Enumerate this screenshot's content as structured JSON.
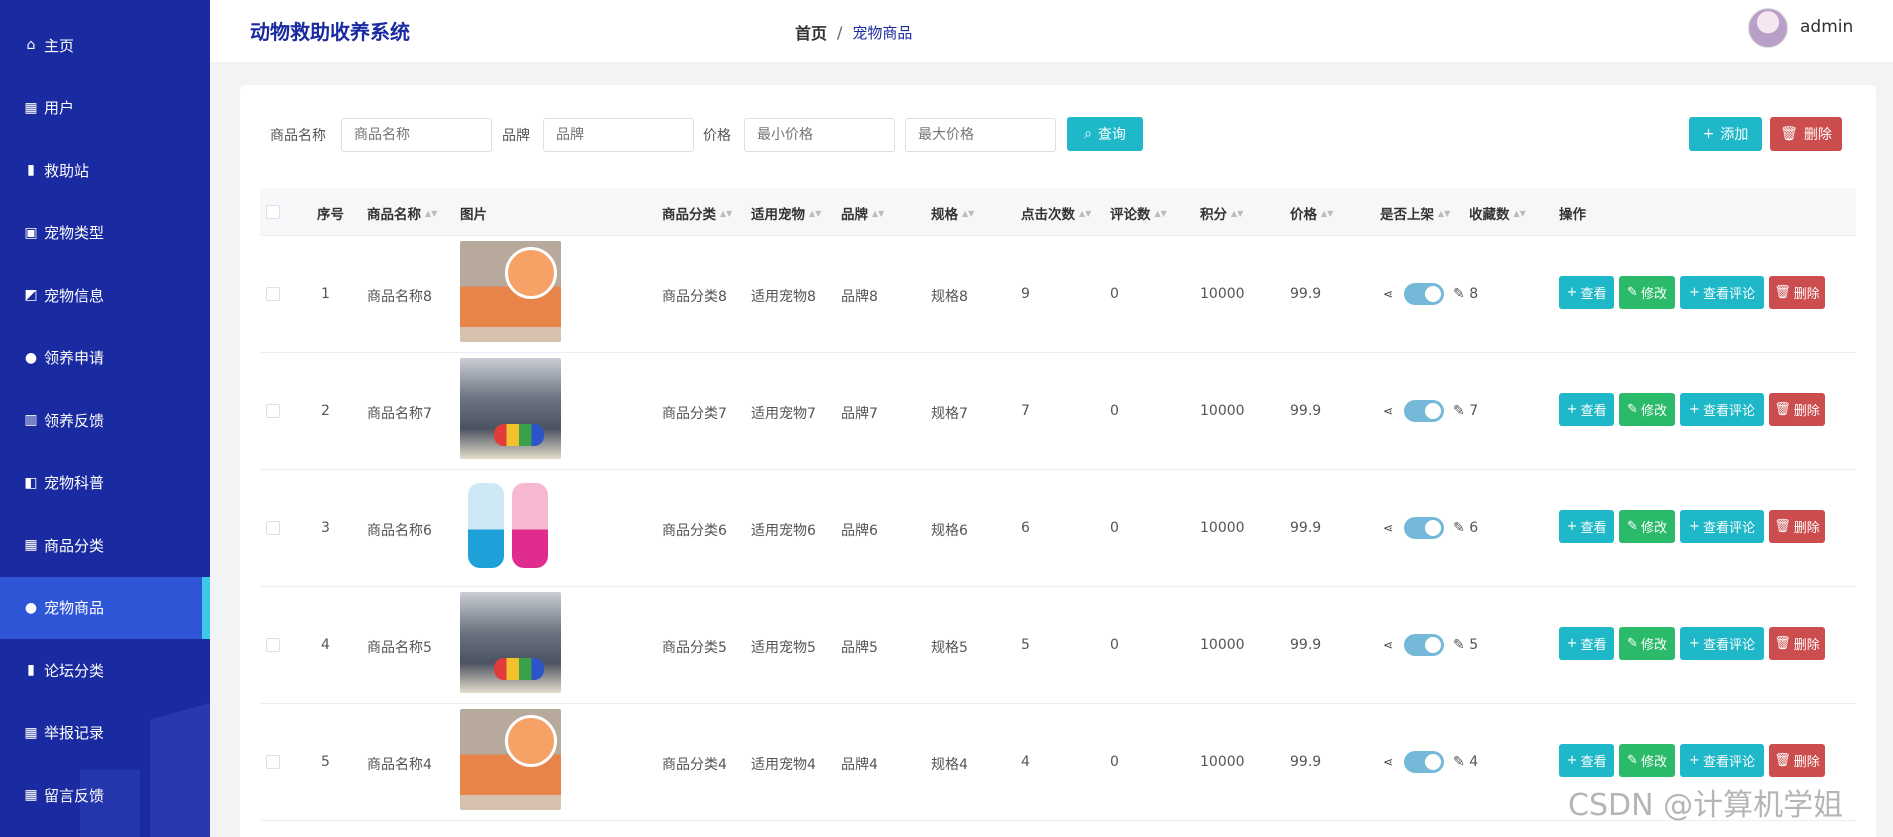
{
  "app": {
    "title": "动物救助收养系统",
    "user": "admin"
  },
  "breadcrumb": {
    "home": "首页",
    "separator": "/",
    "current": "宠物商品"
  },
  "sidebar": {
    "items": [
      {
        "label": "主页",
        "icon": "home-icon",
        "glyph": "⌂"
      },
      {
        "label": "用户",
        "icon": "grid-icon",
        "glyph": "▦"
      },
      {
        "label": "救助站",
        "icon": "bookmark-icon",
        "glyph": "▮"
      },
      {
        "label": "宠物类型",
        "icon": "clipboard-icon",
        "glyph": "▣"
      },
      {
        "label": "宠物信息",
        "icon": "chart-icon",
        "glyph": "◩"
      },
      {
        "label": "领养申请",
        "icon": "user-icon",
        "glyph": "●"
      },
      {
        "label": "领养反馈",
        "icon": "bar-chart-icon",
        "glyph": "▥"
      },
      {
        "label": "宠物科普",
        "icon": "thumbs-up-icon",
        "glyph": "◧"
      },
      {
        "label": "商品分类",
        "icon": "grid-icon",
        "glyph": "▦"
      },
      {
        "label": "宠物商品",
        "icon": "user-icon",
        "glyph": "●",
        "active": true
      },
      {
        "label": "论坛分类",
        "icon": "bookmark-icon",
        "glyph": "▮"
      },
      {
        "label": "举报记录",
        "icon": "grid-icon",
        "glyph": "▦"
      },
      {
        "label": "留言反馈",
        "icon": "grid-icon",
        "glyph": "▦"
      }
    ]
  },
  "filters": {
    "name_label": "商品名称",
    "name_placeholder": "商品名称",
    "brand_label": "品牌",
    "brand_placeholder": "品牌",
    "price_label": "价格",
    "min_price_placeholder": "最小价格",
    "max_price_placeholder": "最大价格",
    "search_button": "查询",
    "add_button": "添加",
    "delete_button": "删除"
  },
  "table": {
    "columns": [
      "序号",
      "商品名称",
      "图片",
      "商品分类",
      "适用宠物",
      "品牌",
      "规格",
      "点击次数",
      "评论数",
      "积分",
      "价格",
      "是否上架",
      "收藏数",
      "操作"
    ],
    "actions": {
      "view": "查看",
      "edit": "修改",
      "comments": "查看评论",
      "delete": "删除"
    },
    "rows": [
      {
        "index": "1",
        "name": "商品名称8",
        "image": "cat-orange",
        "category": "商品分类8",
        "pet": "适用宠物8",
        "brand": "品牌8",
        "spec": "规格8",
        "clicks": "9",
        "comments": "0",
        "points": "10000",
        "price": "99.9",
        "listed": true,
        "favorites": "8"
      },
      {
        "index": "2",
        "name": "商品名称7",
        "image": "cat-gray",
        "category": "商品分类7",
        "pet": "适用宠物7",
        "brand": "品牌7",
        "spec": "规格7",
        "clicks": "7",
        "comments": "0",
        "points": "10000",
        "price": "99.9",
        "listed": true,
        "favorites": "7"
      },
      {
        "index": "3",
        "name": "商品名称6",
        "image": "water",
        "category": "商品分类6",
        "pet": "适用宠物6",
        "brand": "品牌6",
        "spec": "规格6",
        "clicks": "6",
        "comments": "0",
        "points": "10000",
        "price": "99.9",
        "listed": true,
        "favorites": "6"
      },
      {
        "index": "4",
        "name": "商品名称5",
        "image": "cat-gray",
        "category": "商品分类5",
        "pet": "适用宠物5",
        "brand": "品牌5",
        "spec": "规格5",
        "clicks": "5",
        "comments": "0",
        "points": "10000",
        "price": "99.9",
        "listed": true,
        "favorites": "5"
      },
      {
        "index": "5",
        "name": "商品名称4",
        "image": "cat-orange",
        "category": "商品分类4",
        "pet": "适用宠物4",
        "brand": "品牌4",
        "spec": "规格4",
        "clicks": "4",
        "comments": "0",
        "points": "10000",
        "price": "99.9",
        "listed": true,
        "favorites": "4"
      }
    ]
  },
  "watermark": "CSDN @计算机学姐",
  "colors": {
    "sidebar": "#1a2aa0",
    "active": "#2f56d6",
    "teal": "#1fb8c8",
    "green": "#2bba6a",
    "red": "#cc4d4d"
  }
}
